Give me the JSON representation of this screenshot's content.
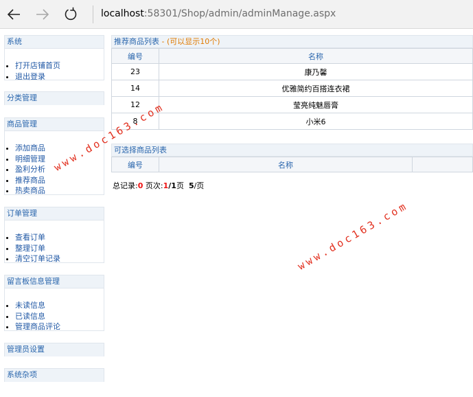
{
  "browser": {
    "url_host": "localhost",
    "url_rest": ":58301/Shop/admin/adminManage.aspx"
  },
  "sidebar": {
    "sections": [
      {
        "title": "系统",
        "items": [
          "打开店铺首页",
          "退出登录"
        ]
      },
      {
        "title": "分类管理",
        "items": []
      },
      {
        "title": "商品管理",
        "items": [
          "添加商品",
          "明细管理",
          "盈利分析",
          "推荐商品",
          "热卖商品"
        ]
      },
      {
        "title": "订单管理",
        "items": [
          "查看订单",
          "整理订单",
          "清空订单记录"
        ]
      },
      {
        "title": "留言板信息管理",
        "items": [
          "未读信息",
          "已读信息",
          "管理商品评论"
        ]
      },
      {
        "title": "管理员设置",
        "items": []
      },
      {
        "title": "系统杂项",
        "items": []
      }
    ]
  },
  "recommended": {
    "title": "推荐商品列表",
    "note": " - (可以显示10个)",
    "headers": [
      "编号",
      "名称"
    ],
    "rows": [
      {
        "id": "23",
        "name": "康乃馨"
      },
      {
        "id": "14",
        "name": "优雅简约百搭连衣裙"
      },
      {
        "id": "12",
        "name": "莹亮纯魅唇膏"
      },
      {
        "id": "8",
        "name": "小米6"
      }
    ]
  },
  "selectable": {
    "title": "可选择商品列表",
    "headers": [
      "编号",
      "名称",
      ""
    ]
  },
  "pager": {
    "records_label": "总记录:",
    "records": "0",
    "page_label": "页次:",
    "page_current": "1",
    "page_sep": "/",
    "page_total": "1",
    "page_unit": "页",
    "per_page": "5",
    "per_unit": "/页"
  },
  "watermark": "www.doc163.com",
  "colors": {
    "link": "#2058a5",
    "header_text": "#2a66ad",
    "note": "#e07a00",
    "watermark": "#e2301f",
    "pager_highlight": "#e11111"
  }
}
